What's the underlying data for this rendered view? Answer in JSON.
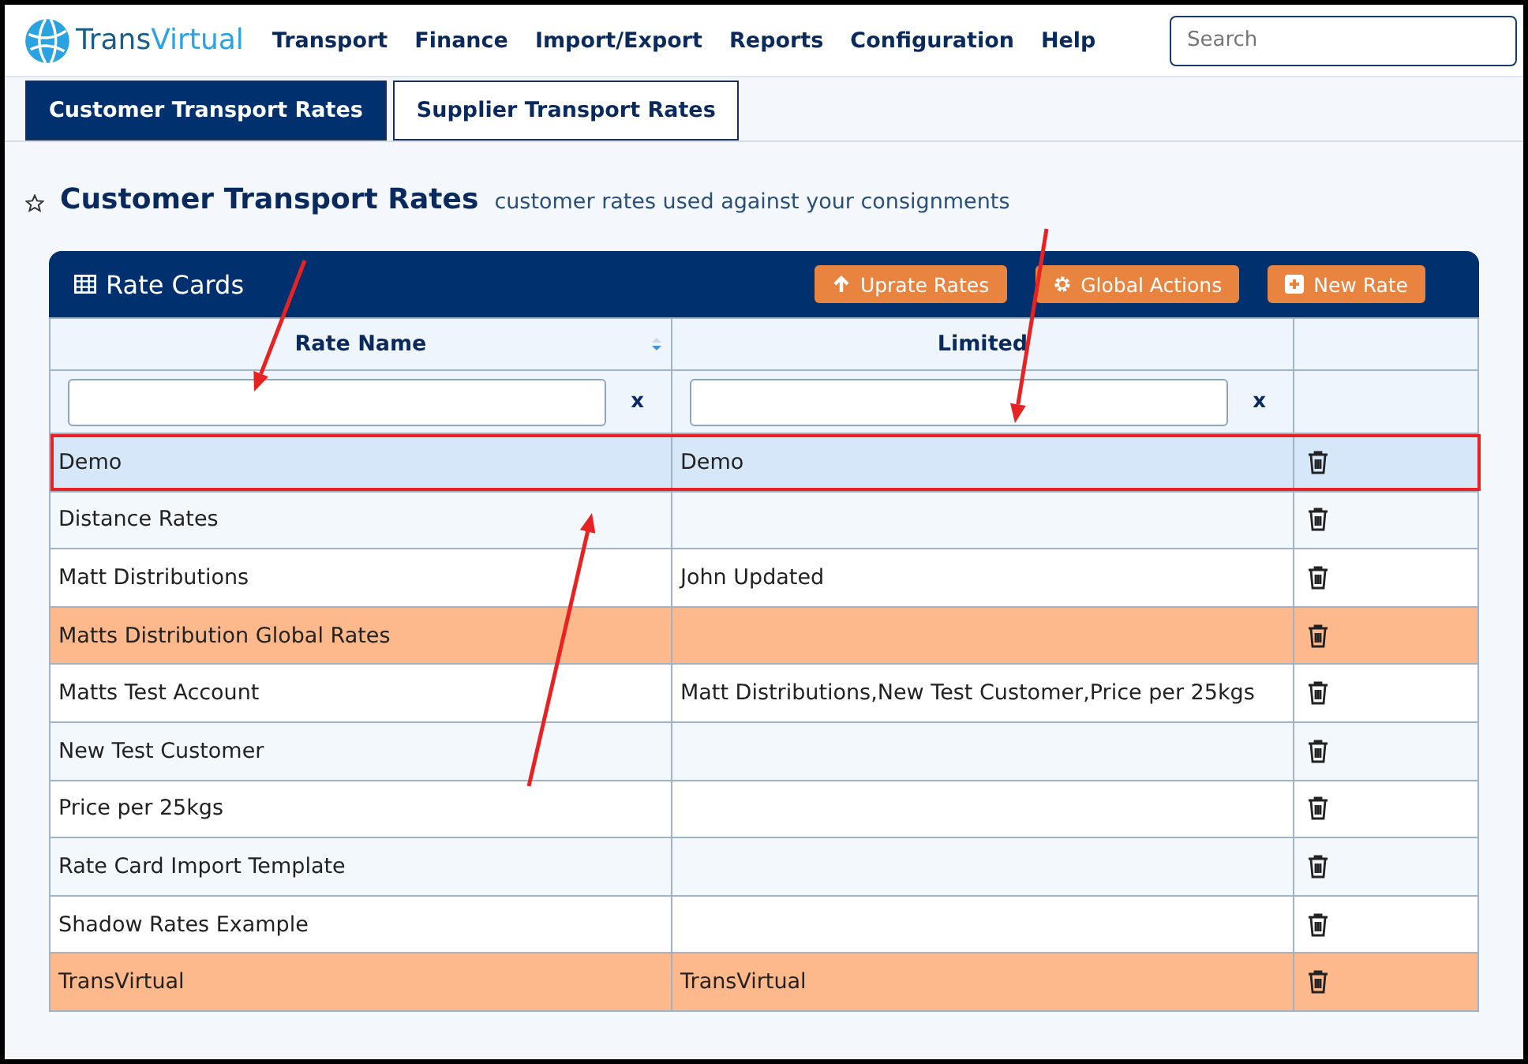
{
  "brand": {
    "name_part_1": "Trans",
    "name_part_2": "Virtual"
  },
  "nav": [
    "Transport",
    "Finance",
    "Import/Export",
    "Reports",
    "Configuration",
    "Help"
  ],
  "search": {
    "placeholder": "Search"
  },
  "tabs": [
    {
      "label": "Customer Transport Rates",
      "selected": true
    },
    {
      "label": "Supplier Transport Rates",
      "selected": false
    }
  ],
  "page": {
    "title": "Customer Transport Rates",
    "subtitle": "customer rates used against your consignments"
  },
  "card": {
    "title": "Rate Cards",
    "buttons": [
      {
        "label": "Uprate Rates",
        "kind": "upload"
      },
      {
        "label": "Global Actions",
        "kind": "gear"
      },
      {
        "label": "New Rate",
        "kind": "plus"
      }
    ]
  },
  "table": {
    "columns": [
      {
        "label": "Rate Name",
        "sortable": true
      },
      {
        "label": "Limited",
        "sortable": false
      }
    ],
    "filter_clear": [
      "x",
      "x"
    ],
    "rows": [
      {
        "name": "Demo",
        "limited": "Demo",
        "selected": true,
        "highlighted": false,
        "outlined": true
      },
      {
        "name": "Distance Rates",
        "limited": "",
        "selected": false,
        "highlighted": false,
        "outlined": false
      },
      {
        "name": "Matt Distributions",
        "limited": "John Updated",
        "selected": false,
        "highlighted": false,
        "outlined": false
      },
      {
        "name": "Matts Distribution Global Rates",
        "limited": "",
        "selected": false,
        "highlighted": true,
        "outlined": false
      },
      {
        "name": "Matts Test Account",
        "limited": "Matt Distributions,New Test Customer,Price per 25kgs",
        "selected": false,
        "highlighted": false,
        "outlined": false
      },
      {
        "name": "New Test Customer",
        "limited": "",
        "selected": false,
        "highlighted": false,
        "outlined": false
      },
      {
        "name": "Price per 25kgs",
        "limited": "",
        "selected": false,
        "highlighted": false,
        "outlined": false
      },
      {
        "name": "Rate Card Import Template",
        "limited": "",
        "selected": false,
        "highlighted": false,
        "outlined": false
      },
      {
        "name": "Shadow Rates Example",
        "limited": "",
        "selected": false,
        "highlighted": false,
        "outlined": false
      },
      {
        "name": "TransVirtual",
        "limited": "TransVirtual",
        "selected": false,
        "highlighted": true,
        "outlined": false
      }
    ]
  }
}
